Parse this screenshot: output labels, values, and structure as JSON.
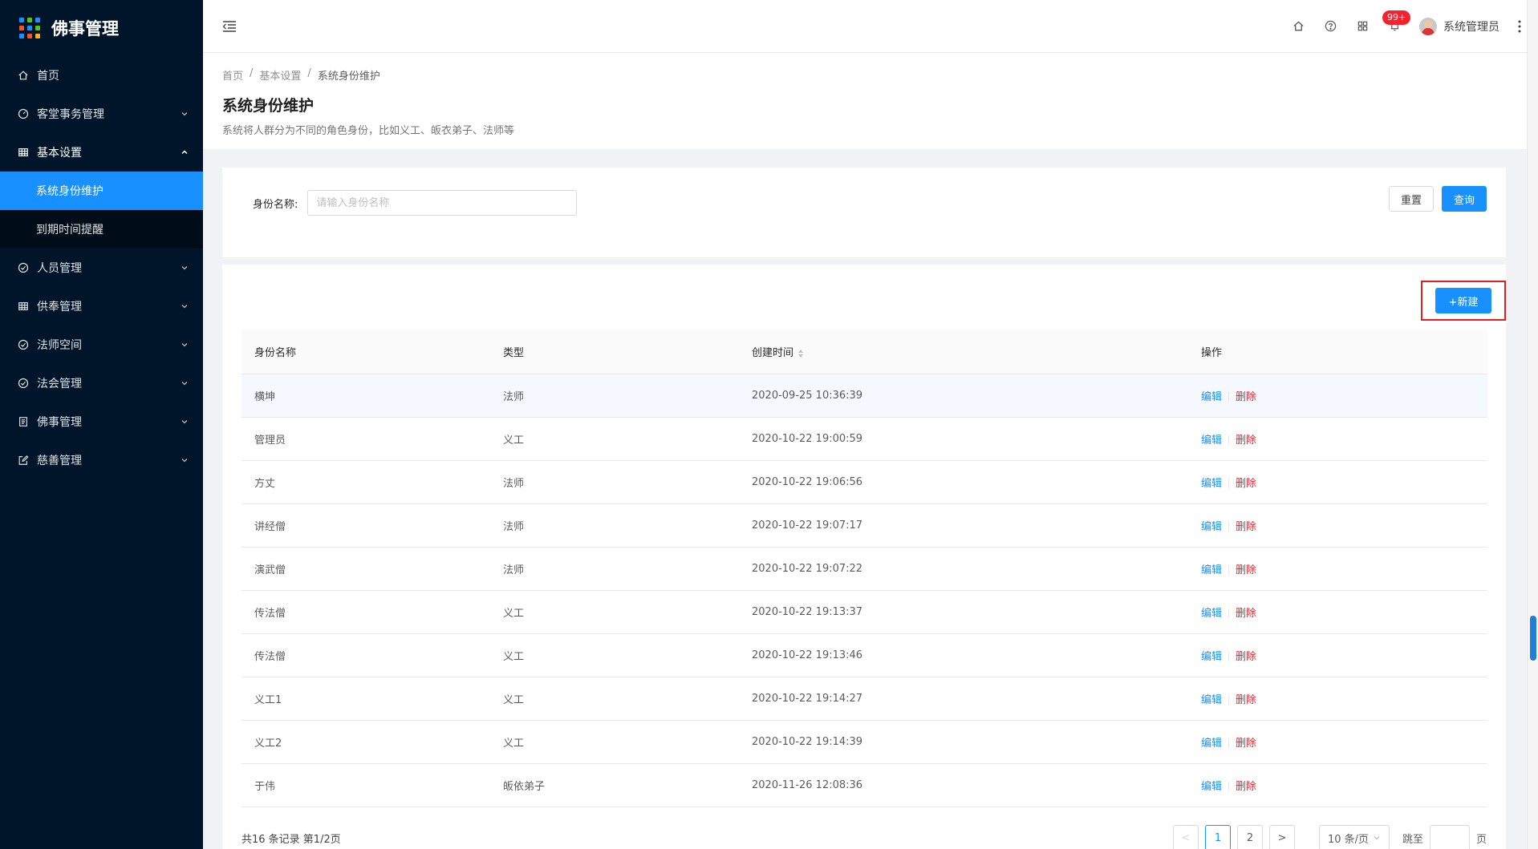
{
  "app": {
    "title": "佛事管理"
  },
  "sidebar": {
    "items": [
      {
        "label": "首页",
        "icon": "home-icon"
      },
      {
        "label": "客堂事务管理",
        "icon": "dashboard-icon"
      },
      {
        "label": "基本设置",
        "icon": "table-icon"
      },
      {
        "label": "人员管理",
        "icon": "check-circle-icon"
      },
      {
        "label": "供奉管理",
        "icon": "table-icon"
      },
      {
        "label": "法师空间",
        "icon": "check-circle-icon"
      },
      {
        "label": "法会管理",
        "icon": "check-circle-icon"
      },
      {
        "label": "佛事管理",
        "icon": "profile-icon"
      },
      {
        "label": "慈善管理",
        "icon": "edit-icon"
      }
    ],
    "submenu": [
      {
        "label": "系统身份维护"
      },
      {
        "label": "到期时间提醒"
      }
    ]
  },
  "header": {
    "notification_count": "99+",
    "user_name": "系统管理员"
  },
  "breadcrumb": [
    "首页",
    "基本设置",
    "系统身份维护"
  ],
  "page": {
    "title": "系统身份维护",
    "description": "系统将人群分为不同的角色身份，比如义工、皈衣弟子、法师等"
  },
  "search": {
    "label": "身份名称:",
    "placeholder": "请输入身份名称",
    "reset_label": "重置",
    "query_label": "查询"
  },
  "table": {
    "new_label": "+新建",
    "columns": [
      "身份名称",
      "类型",
      "创建时间",
      "操作"
    ],
    "edit_label": "编辑",
    "delete_label": "删除",
    "rows": [
      {
        "name": "横坤",
        "type": "法师",
        "created": "2020-09-25 10:36:39"
      },
      {
        "name": "管理员",
        "type": "义工",
        "created": "2020-10-22 19:00:59"
      },
      {
        "name": "方丈",
        "type": "法师",
        "created": "2020-10-22 19:06:56"
      },
      {
        "name": "讲经僧",
        "type": "法师",
        "created": "2020-10-22 19:07:17"
      },
      {
        "name": "演武僧",
        "type": "法师",
        "created": "2020-10-22 19:07:22"
      },
      {
        "name": "传法僧",
        "type": "义工",
        "created": "2020-10-22 19:13:37"
      },
      {
        "name": "传法僧",
        "type": "义工",
        "created": "2020-10-22 19:13:46"
      },
      {
        "name": "义工1",
        "type": "义工",
        "created": "2020-10-22 19:14:27"
      },
      {
        "name": "义工2",
        "type": "义工",
        "created": "2020-10-22 19:14:39"
      },
      {
        "name": "于伟",
        "type": "皈依弟子",
        "created": "2020-11-26 12:08:36"
      }
    ]
  },
  "pagination": {
    "total_text": "共16 条记录 第1/2页",
    "pages": [
      "1",
      "2"
    ],
    "prev": "<",
    "next": ">",
    "page_size": "10 条/页",
    "jump_label": "跳至",
    "page_suffix": "页"
  },
  "colors": {
    "primary": "#1890ff",
    "sidebar_bg": "#001529",
    "danger": "#f5222d",
    "highlight_border": "#e02020"
  }
}
